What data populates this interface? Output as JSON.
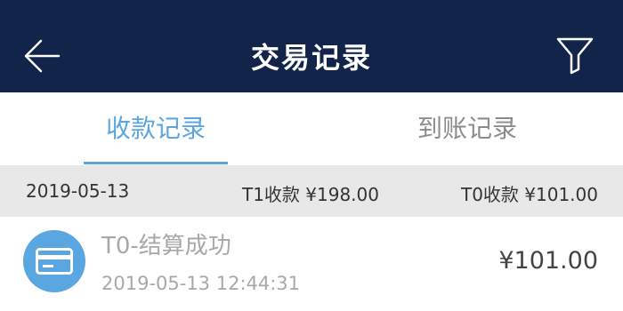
{
  "header": {
    "title": "交易记录",
    "back_icon": "back-arrow-icon",
    "filter_icon": "filter-funnel-icon",
    "background": "#12244a"
  },
  "tabs": [
    {
      "label": "收款记录",
      "active": true
    },
    {
      "label": "到账记录",
      "active": false
    }
  ],
  "accent_color": "#5aa6e0",
  "summary": {
    "date": "2019-05-13",
    "t1_total": "T1收款 ¥198.00",
    "t0_total": "T0收款 ¥101.00"
  },
  "records": [
    {
      "icon": "credit-card-icon",
      "title": "T0-结算成功",
      "time": "2019-05-13 12:44:31",
      "amount": "¥101.00"
    }
  ]
}
